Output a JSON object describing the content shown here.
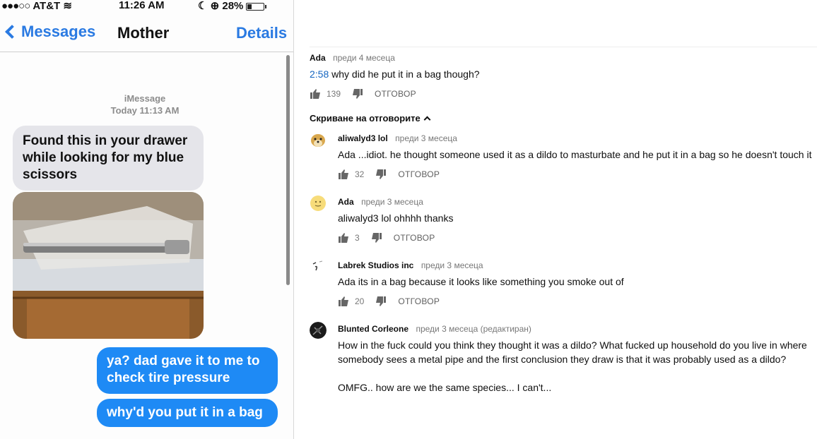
{
  "phone": {
    "status": {
      "carrier": "AT&T",
      "time": "11:26 AM",
      "battery": "28%"
    },
    "nav": {
      "back_label": "Messages",
      "title": "Mother",
      "details_label": "Details"
    },
    "imessage_header": {
      "service": "iMessage",
      "date": "Today 11:13 AM"
    },
    "messages": [
      {
        "from": "mother",
        "text": "Found this in your drawer while looking for my blue scissors"
      },
      {
        "from": "me",
        "text": "ya? dad gave it to me to check tire pressure"
      },
      {
        "from": "me",
        "text": "why'd you put it in a bag"
      }
    ]
  },
  "comments": {
    "main": {
      "author": "Ada",
      "meta": "преди 4 месеца",
      "timestamp_link": "2:58",
      "text": " why did he put it in a bag though?",
      "likes": "139",
      "reply_label": "ОТГОВОР"
    },
    "hide_replies_label": "Скриване на отговорите",
    "replies": [
      {
        "author": "aliwalyd3 lol",
        "meta": "преди 3 месеца",
        "text": "Ada ...idiot. he thought someone used it as a dildo to masturbate and he put it in a bag so he doesn't touch it",
        "likes": "32",
        "reply_label": "ОТГОВОР",
        "avatar": "doge-avatar"
      },
      {
        "author": "Ada",
        "meta": "преди 3 месеца",
        "text": "aliwalyd3 lol ohhhh thanks",
        "likes": "3",
        "reply_label": "ОТГОВОР",
        "avatar": "smiley-avatar"
      },
      {
        "author": "Labrek Studios inc",
        "meta": "преди 3 месеца",
        "text": "Ada its in a bag because it looks like something you smoke out of",
        "likes": "20",
        "reply_label": "ОТГОВОР",
        "avatar": "logo-avatar"
      },
      {
        "author": "Blunted Corleone",
        "meta": "преди 3 месеца (редактиран)",
        "text_line1": "How in the fuck could you think they thought it was a dildo? What fucked up household do you live in where",
        "text_line2": "somebody sees a metal pipe and the first conclusion they draw is that it was probably used as a dildo?",
        "text_line3": "OMFG.. how are we the same species... I can't...",
        "avatar": "dark-avatar"
      }
    ]
  },
  "colors": {
    "ios_blue": "#1e8af5",
    "link_blue": "#1565c0",
    "incoming_bubble": "#e5e5ea"
  }
}
